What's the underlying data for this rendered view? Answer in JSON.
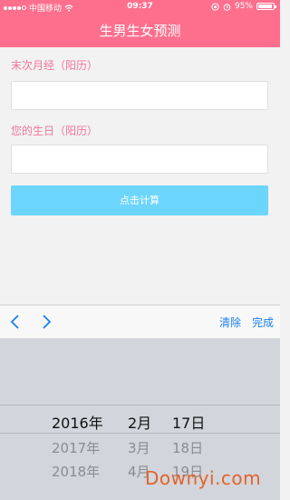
{
  "status_bar": {
    "carrier": "中国移动",
    "time": "09:37",
    "battery_percent": "95%",
    "battery_level": 0.95
  },
  "header": {
    "title": "生男生女预测"
  },
  "form": {
    "last_period_label": "末次月经（阳历）",
    "birthday_label": "您的生日（阳历）",
    "last_period_value": "",
    "birthday_value": "",
    "calculate_button": "点击计算"
  },
  "picker_toolbar": {
    "prev_icon": "chevron-left-icon",
    "next_icon": "chevron-right-icon",
    "clear_label": "清除",
    "done_label": "完成"
  },
  "date_picker": {
    "selected": {
      "year": "2016年",
      "month": "2月",
      "day": "17日"
    },
    "next_1": {
      "year": "2017年",
      "month": "3月",
      "day": "18日"
    },
    "next_2": {
      "year": "2018年",
      "month": "4月",
      "day": "19日"
    }
  },
  "watermark": {
    "text": "Downyi.com"
  },
  "colors": {
    "brand_pink": "#fe6f8e",
    "label_pink": "#f2759b",
    "button_blue": "#6cd5fb",
    "link_blue": "#1b7ff2"
  }
}
